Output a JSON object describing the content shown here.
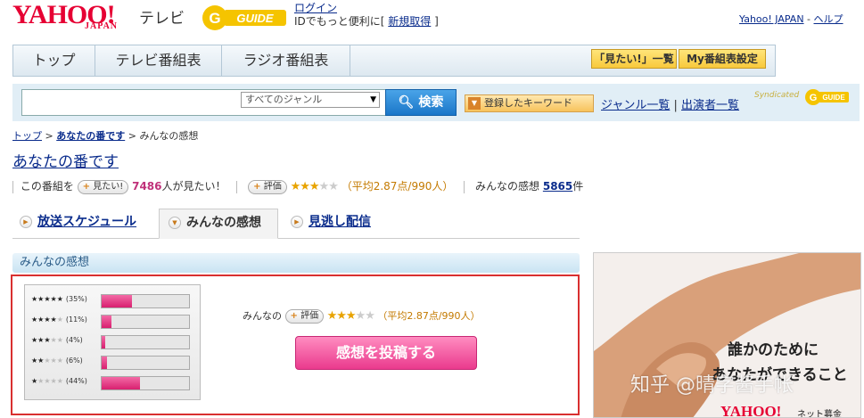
{
  "header": {
    "yahoo_logo": "YAHOO!",
    "japan_logo": "JAPAN",
    "tv_label": "テレビ",
    "gguide_logo": "G-GUIDE",
    "login_link": "ログイン",
    "login_desc_prefix": "IDでもっと便利に[",
    "register_link": "新規取得",
    "login_desc_suffix": "]",
    "yahoo_japan_link": "Yahoo! JAPAN",
    "separator": " - ",
    "help_link": "ヘルプ"
  },
  "nav": {
    "tabs": [
      {
        "label": "トップ"
      },
      {
        "label": "テレビ番組表"
      },
      {
        "label": "ラジオ番組表"
      }
    ],
    "want_list_button": "「見たい!」一覧",
    "my_guide_button": "My番組表設定"
  },
  "search": {
    "query_value": "",
    "genre_selected": "すべてのジャンル",
    "search_button": "検索",
    "keyword_button": "登録したキーワード",
    "genre_list_link": "ジャンル一覧",
    "link_separator": "|",
    "performer_list_link": "出演者一覧",
    "syndicated_label": "Syndicated"
  },
  "breadcrumb": {
    "items": [
      "トップ",
      "あなたの番です",
      "みんなの感想"
    ],
    "separator": ">"
  },
  "program": {
    "title": "あなたの番です",
    "want_prefix": "この番組を",
    "want_button": "見たい!",
    "want_count": "7486",
    "want_suffix": "人が見たい！",
    "rate_button": "評価",
    "avg_text": "（平均2.87点/990人）",
    "reviews_label": "みんなの感想",
    "reviews_count": "5865",
    "reviews_suffix": "件"
  },
  "subtabs": [
    {
      "label": "放送スケジュール",
      "active": false
    },
    {
      "label": "みんなの感想",
      "active": true
    },
    {
      "label": "見逃し配信",
      "active": false
    }
  ],
  "reviews": {
    "section_title": "みんなの感想",
    "distribution": [
      {
        "stars_on": 5,
        "pct_label": "(35%)",
        "pct": 35
      },
      {
        "stars_on": 4,
        "pct_label": "(11%)",
        "pct": 11
      },
      {
        "stars_on": 3,
        "pct_label": "(4%)",
        "pct": 4
      },
      {
        "stars_on": 2,
        "pct_label": "(6%)",
        "pct": 6
      },
      {
        "stars_on": 1,
        "pct_label": "(44%)",
        "pct": 44
      }
    ],
    "summary_prefix": "みんなの",
    "rate_button": "評価",
    "avg_text": "（平均2.87点/990人）",
    "post_button": "感想を投稿する"
  },
  "ad": {
    "line1": "誰かのために",
    "line2": "あなたができること",
    "yahoo_logo": "YAHOO!",
    "bokin_label": "ネット募金"
  },
  "watermark": "知乎 @晴字酱手帐",
  "colors": {
    "yahoo_red": "#e60033",
    "link_blue": "#0a2c8c",
    "pink_bar": "#e8307e",
    "highlight_border": "#d93030"
  }
}
